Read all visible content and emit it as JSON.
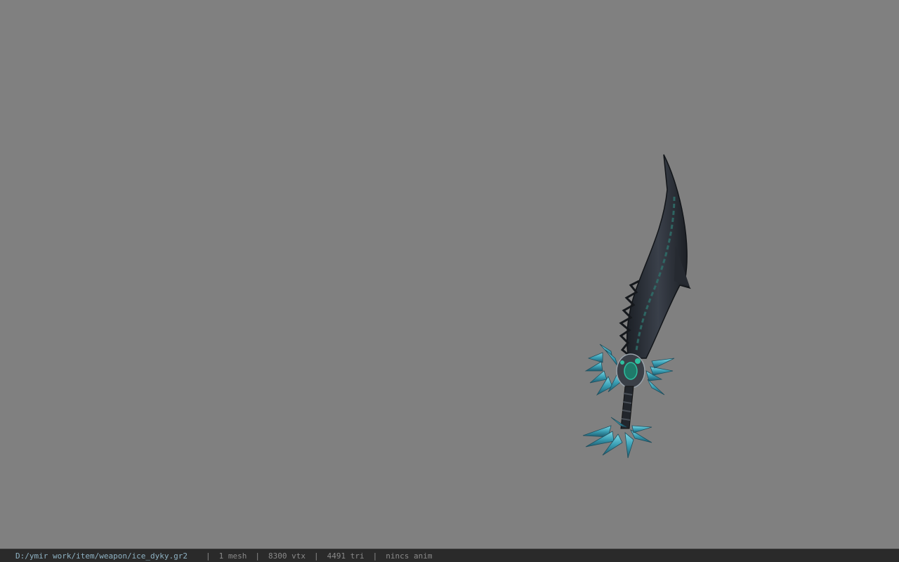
{
  "viewport": {
    "background": "#808080",
    "model_name": "ice_dyky"
  },
  "status": {
    "path": "D:/ymir work/item/weapon/ice_dyky.gr2",
    "mesh": "1 mesh",
    "vtx": "8300 vtx",
    "tri": "4491 tri",
    "anim": "nincs anim",
    "separator": "|"
  },
  "colors": {
    "path": "#8fb3c4",
    "statusbar_bg": "#2a2a2a",
    "blade": "#2b2f36",
    "crystal": "#4fb3c8"
  }
}
